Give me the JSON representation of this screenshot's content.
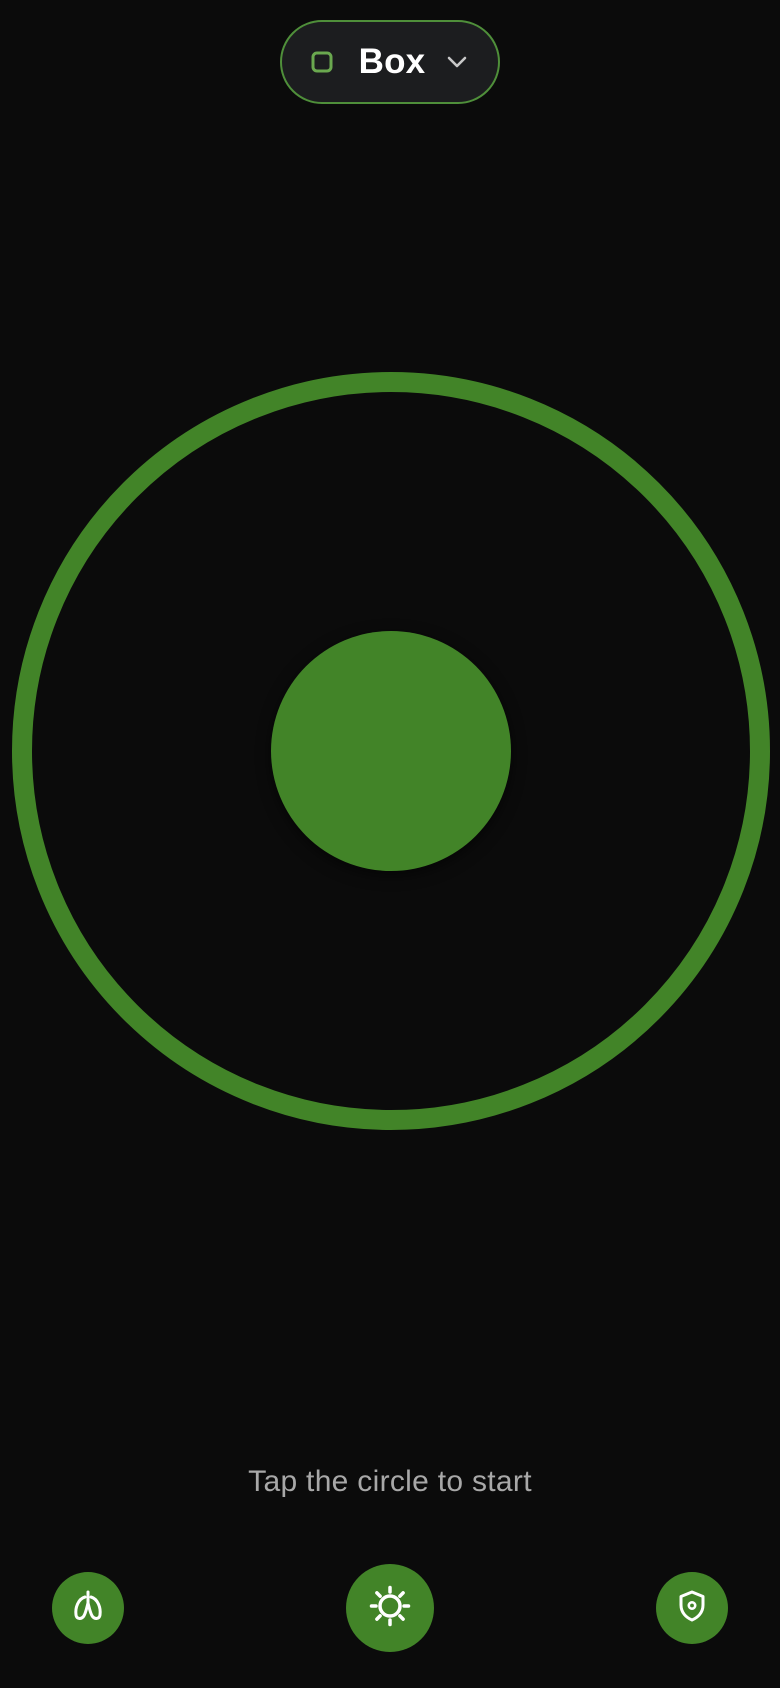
{
  "mode_selector": {
    "label": "Box",
    "icon": "square-icon",
    "dropdown_icon": "chevron-down-icon"
  },
  "breathing_circle": {
    "state": "idle"
  },
  "hint": {
    "text": "Tap the circle to start"
  },
  "bottom_bar": {
    "left_icon": "lungs-icon",
    "center_icon": "sun-icon",
    "right_icon": "shield-icon"
  },
  "colors": {
    "background": "#0b0b0b",
    "accent": "#428428",
    "pill_border": "#4f8f3a",
    "pill_background": "#1c1d1f",
    "hint_text": "#a8a8a8"
  }
}
